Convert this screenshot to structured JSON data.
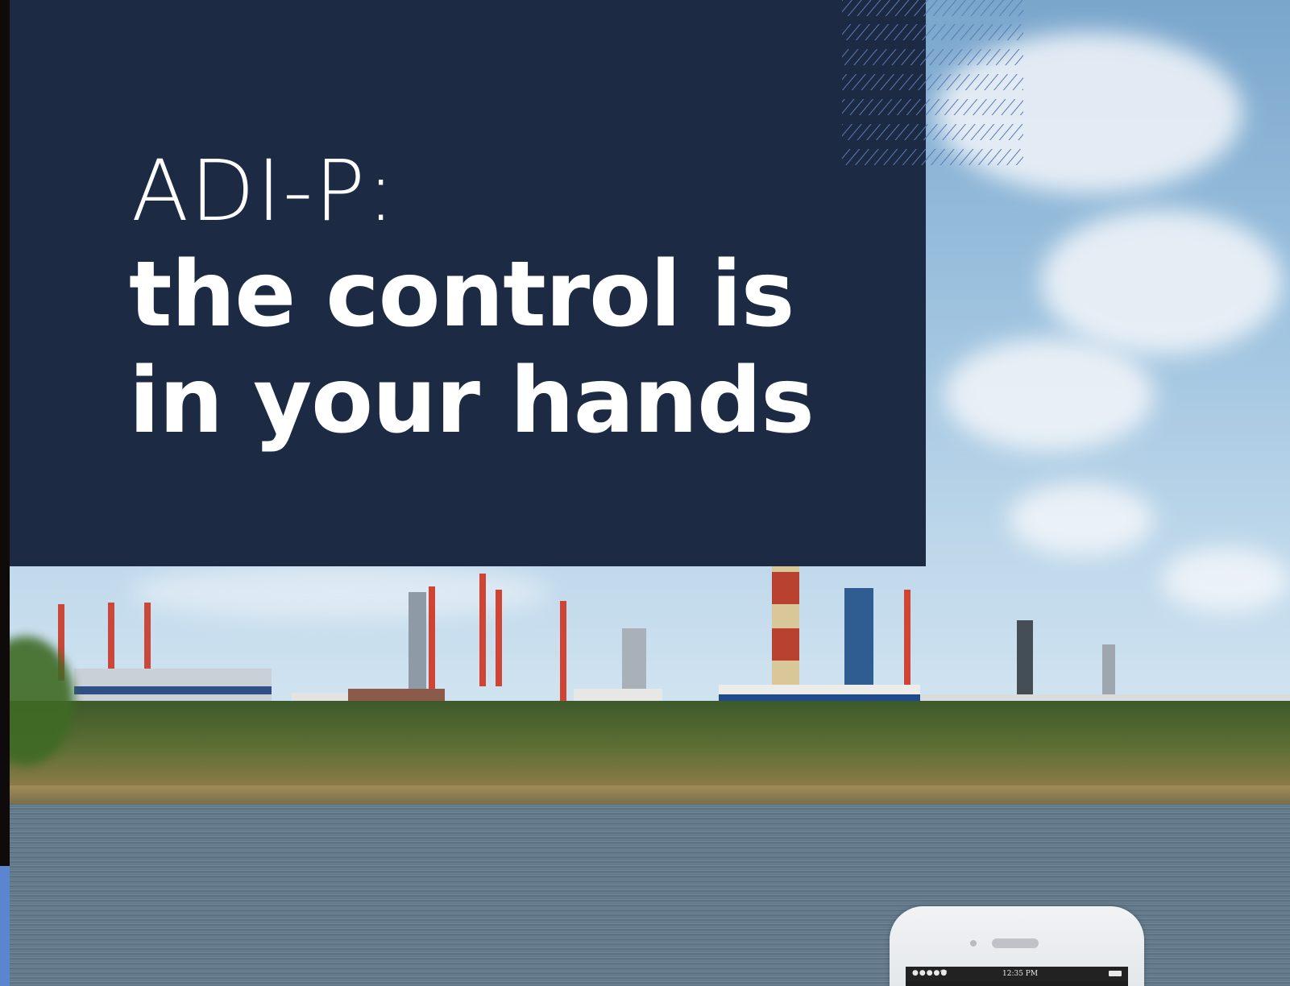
{
  "hero": {
    "title_line1": "ADI-P:",
    "title_line2": "the control is in your hands"
  },
  "phone": {
    "status_signal": "●●●●●",
    "status_wifi": "wifi-icon",
    "status_time": "12:35 PM",
    "status_battery": "battery-icon"
  },
  "colors": {
    "panel": "#1c2b43",
    "accent_edge": "#5b86cf",
    "chimney_red": "#b8412f",
    "chimney_cream": "#d9c79a"
  }
}
